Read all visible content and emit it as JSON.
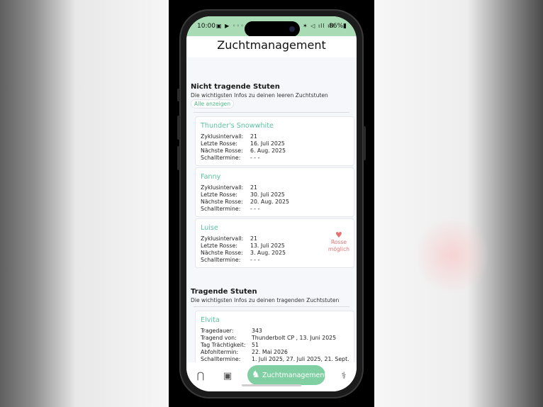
{
  "statusbar": {
    "time": "10:00",
    "left_icons": "▣ ▶ ◦◦◦",
    "right_icons": "✶ ◁ ıll ıll",
    "battery": "86%▮"
  },
  "app": {
    "title": "Zuchtmanagement"
  },
  "empty_section": {
    "title": "Nicht tragende Stuten",
    "subtitle": "Die wichtigsten Infos zu deinen leeren Zuchtstuten",
    "show_all": "Alle anzeigen",
    "field_labels": {
      "cycle": "Zyklusintervall:",
      "last": "Letzte Rosse:",
      "next": "Nächste Rosse:",
      "scan": "Schalltermine:"
    },
    "mares": [
      {
        "name": "Thunder's Snowwhite",
        "cycle": "21",
        "last": "16. Juli 2025",
        "next": "6. Aug. 2025",
        "scan": "- - -"
      },
      {
        "name": "Fanny",
        "cycle": "21",
        "last": "30. Juli 2025",
        "next": "20. Aug. 2025",
        "scan": "- - -"
      },
      {
        "name": "Luise",
        "cycle": "21",
        "last": "13. Juli 2025",
        "next": "3. Aug. 2025",
        "scan": "- - -",
        "hint_line1": "Rosse",
        "hint_line2": "möglich"
      }
    ]
  },
  "pregnant_section": {
    "title": "Tragende Stuten",
    "subtitle": "Die wichtigsten Infos zu deinen tragenden Zuchtstuten",
    "field_labels": {
      "duration": "Tragedauer:",
      "by": "Tragend von:",
      "day": "Tag Trächtigkeit:",
      "foaling": "Abfohltermin:",
      "scan": "Schalltermine:"
    },
    "mares": [
      {
        "name": "Elvita",
        "duration": "343",
        "by": "Thunderbolt CP , 13. Juni 2025",
        "day": "51",
        "foaling": "22. Mai 2026",
        "scan": "1. Juli 2025, 27. Juli 2025, 21. Sept."
      }
    ]
  },
  "bottomnav": {
    "active_label": "Zuchtmanagement"
  },
  "colors": {
    "accent": "#5cc1a3",
    "status_green": "#a9dcb4",
    "pill_green": "#7fcfa3",
    "hint_red": "#e57373"
  }
}
